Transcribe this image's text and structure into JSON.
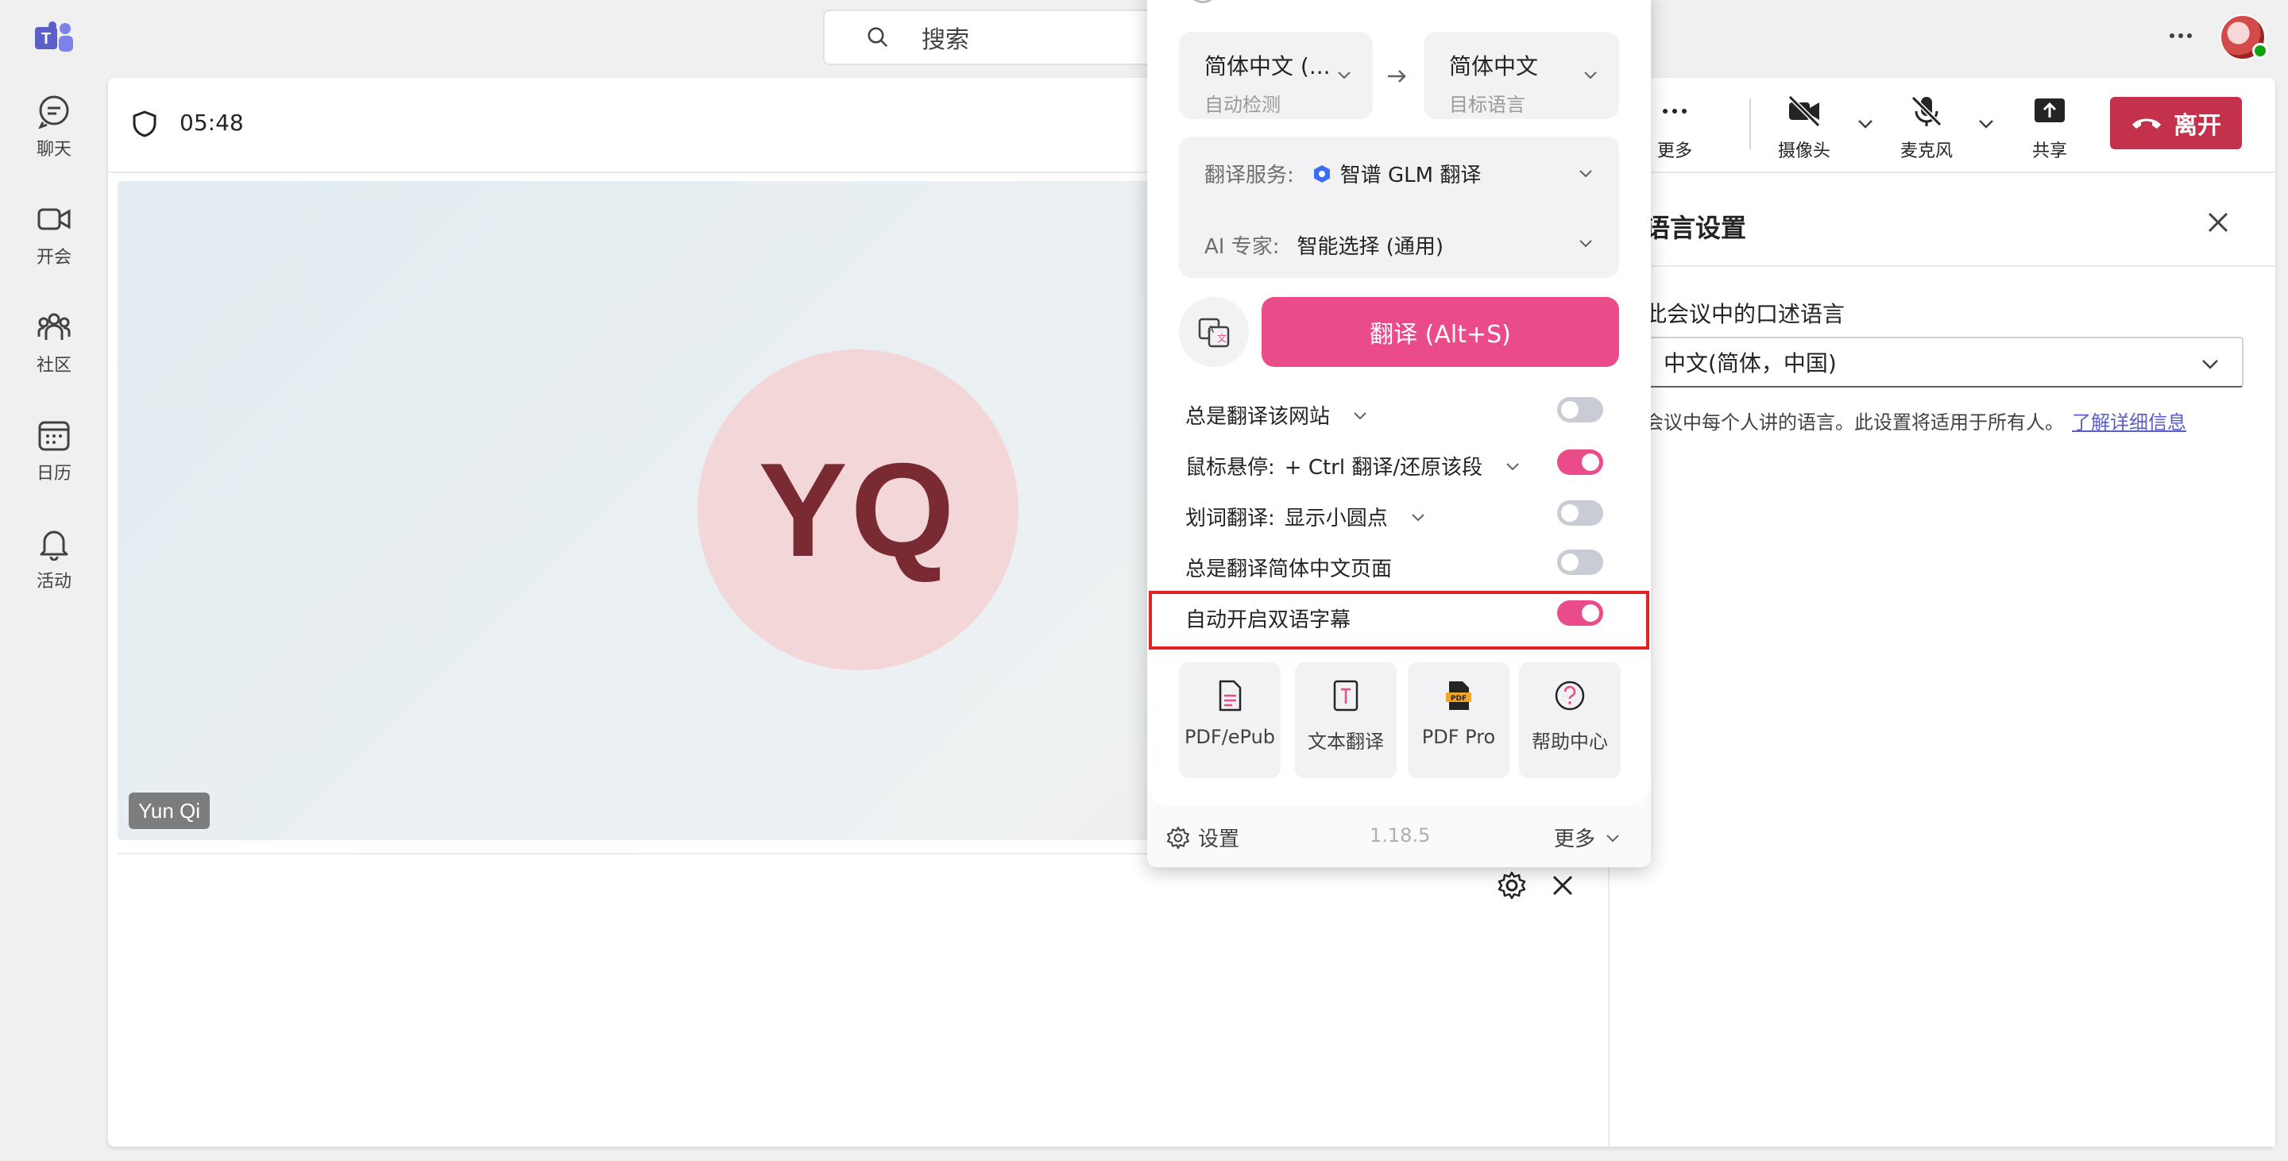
{
  "app": {
    "logo": "teams-logo"
  },
  "search": {
    "placeholder": "搜索"
  },
  "topbar": {
    "more": "more-horizontal-icon",
    "avatar": "user-avatar"
  },
  "sidebar": {
    "items": [
      {
        "label": "聊天",
        "icon": "chat-icon"
      },
      {
        "label": "开会",
        "icon": "video-camera-icon"
      },
      {
        "label": "社区",
        "icon": "community-icon"
      },
      {
        "label": "日历",
        "icon": "calendar-icon"
      },
      {
        "label": "活动",
        "icon": "bell-icon"
      }
    ]
  },
  "meeting": {
    "timer": "05:48",
    "participant": {
      "initials": "YQ",
      "name": "Yun Qi"
    },
    "persona_color": "#f2d6d8"
  },
  "toolbar": {
    "more": "更多",
    "camera": "摄像头",
    "mic": "麦克风",
    "share": "共享",
    "leave": "离开",
    "leave_color": "#c4314b"
  },
  "language_pane": {
    "title": "语言设置",
    "label": "此会议中的口述语言",
    "selected": "中文(简体，中国)",
    "description": "会议中每个人讲的语言。此设置将适用于所有人。",
    "link": "了解详细信息"
  },
  "translator": {
    "source_lang": "简体中文 (...",
    "source_sub": "自动检测",
    "target_lang": "简体中文",
    "target_sub": "目标语言",
    "service_label": "翻译服务:",
    "service_value": "智谱 GLM 翻译",
    "expert_label": "AI 专家:",
    "expert_value": "智能选择 (通用)",
    "translate_button": "翻译 (Alt+S)",
    "accent": "#ea4c89",
    "options": [
      {
        "label": "总是翻译该网站",
        "enabled": false
      },
      {
        "label": "鼠标悬停:",
        "value": "+ Ctrl 翻译/还原该段",
        "enabled": true
      },
      {
        "label": "划词翻译:",
        "value": "显示小圆点",
        "enabled": false
      },
      {
        "label": "总是翻译简体中文页面",
        "enabled": false
      },
      {
        "label": "自动开启双语字幕",
        "enabled": true
      }
    ],
    "tools": [
      {
        "label": "PDF/ePub",
        "icon": "pdf-file-icon"
      },
      {
        "label": "文本翻译",
        "icon": "text-file-icon"
      },
      {
        "label": "PDF Pro",
        "icon": "pdf-pro-icon"
      },
      {
        "label": "帮助中心",
        "icon": "help-icon"
      }
    ],
    "footer": {
      "settings": "设置",
      "version": "1.18.5",
      "more": "更多"
    }
  }
}
